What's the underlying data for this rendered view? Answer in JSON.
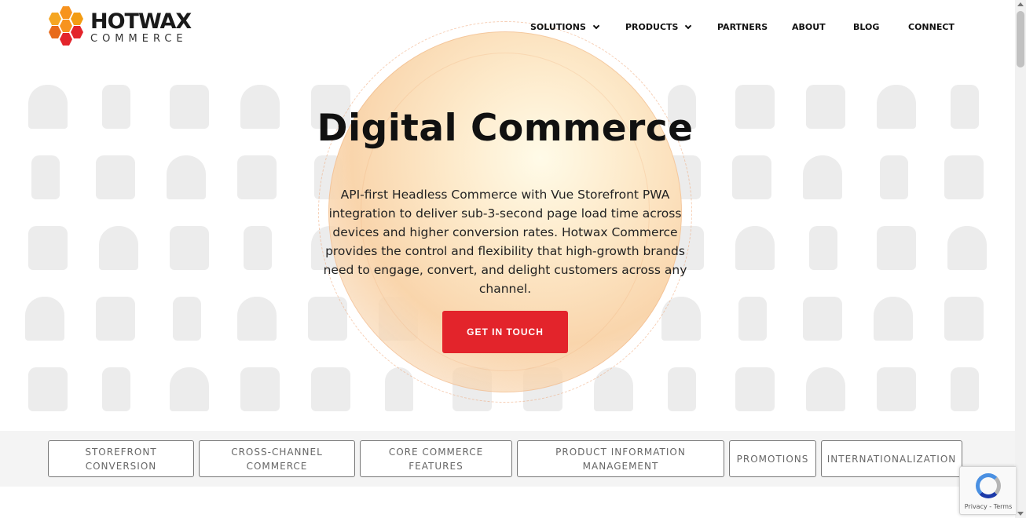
{
  "brand": {
    "name_line1": "HOTWAX",
    "name_line2": "COMMERCE",
    "colors": {
      "hex_orange": "#f7931e",
      "hex_red": "#e3242b",
      "hex_dark": "#e86a1a"
    }
  },
  "nav": {
    "items": [
      {
        "label": "SOLUTIONS",
        "has_dropdown": true
      },
      {
        "label": "PRODUCTS",
        "has_dropdown": true
      },
      {
        "label": "PARTNERS",
        "has_dropdown": false
      },
      {
        "label": "ABOUT",
        "has_dropdown": false
      },
      {
        "label": "BLOG",
        "has_dropdown": false
      },
      {
        "label": "CONNECT",
        "has_dropdown": false
      }
    ]
  },
  "hero": {
    "title": "Digital Commerce",
    "description": "API-first Headless Commerce with Vue Storefront PWA integration to deliver sub-3-second page load time across devices and higher conversion rates. Hotwax Commerce provides the control and flexibility that high-growth brands need to engage, convert, and delight customers across any channel.",
    "cta_label": "GET IN TOUCH"
  },
  "tabs": [
    {
      "line1": "STOREFRONT",
      "line2": "CONVERSION"
    },
    {
      "line1": "CROSS-CHANNEL",
      "line2": "COMMERCE"
    },
    {
      "line1": "CORE COMMERCE",
      "line2": "FEATURES"
    },
    {
      "line1": "PRODUCT INFORMATION",
      "line2": "MANAGEMENT"
    },
    {
      "line1": "PROMOTIONS",
      "line2": ""
    },
    {
      "line1": "INTERNATIONALIZATION",
      "line2": ""
    }
  ],
  "recaptcha": {
    "links": "Privacy - Terms"
  },
  "theme": {
    "accent": "#e3242b",
    "strip_bg": "#f4f4f4",
    "pattern": "#ececec"
  }
}
